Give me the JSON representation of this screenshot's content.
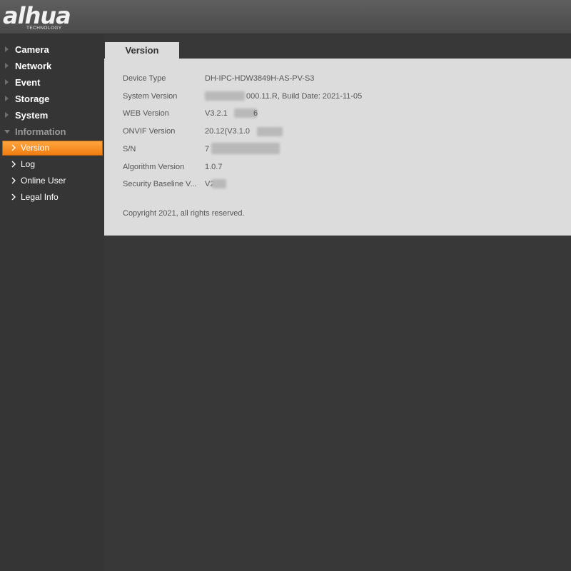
{
  "header": {
    "logo": {
      "brand": "alhua",
      "tagline": "TECHNOLOGY"
    }
  },
  "sidebar": {
    "menu": [
      {
        "label": "Camera"
      },
      {
        "label": "Network"
      },
      {
        "label": "Event"
      },
      {
        "label": "Storage"
      },
      {
        "label": "System"
      },
      {
        "label": "Information"
      }
    ],
    "submenu": [
      {
        "label": "Version",
        "active": true
      },
      {
        "label": "Log"
      },
      {
        "label": "Online User"
      },
      {
        "label": "Legal Info"
      }
    ]
  },
  "tab": {
    "label": "Version"
  },
  "info": [
    {
      "label": "Device Type",
      "value": "DH-IPC-HDW3849H-AS-PV-S3"
    },
    {
      "label": "System Version",
      "value": "000.11.R, Build Date: 2021-11-05"
    },
    {
      "label": "WEB Version",
      "value": "V3.2.1",
      "value_tail": "6"
    },
    {
      "label": "ONVIF Version",
      "value": "20.12(V3.1.0"
    },
    {
      "label": "S/N",
      "value": "7"
    },
    {
      "label": "Algorithm Version",
      "value": "1.0.7"
    },
    {
      "label": "Security Baseline V...",
      "value": "V2"
    }
  ],
  "copyright": "Copyright 2021, all rights reserved.",
  "colors": {
    "accent": "#f08c20",
    "panel": "#dcdcdc",
    "background": "#383838"
  }
}
